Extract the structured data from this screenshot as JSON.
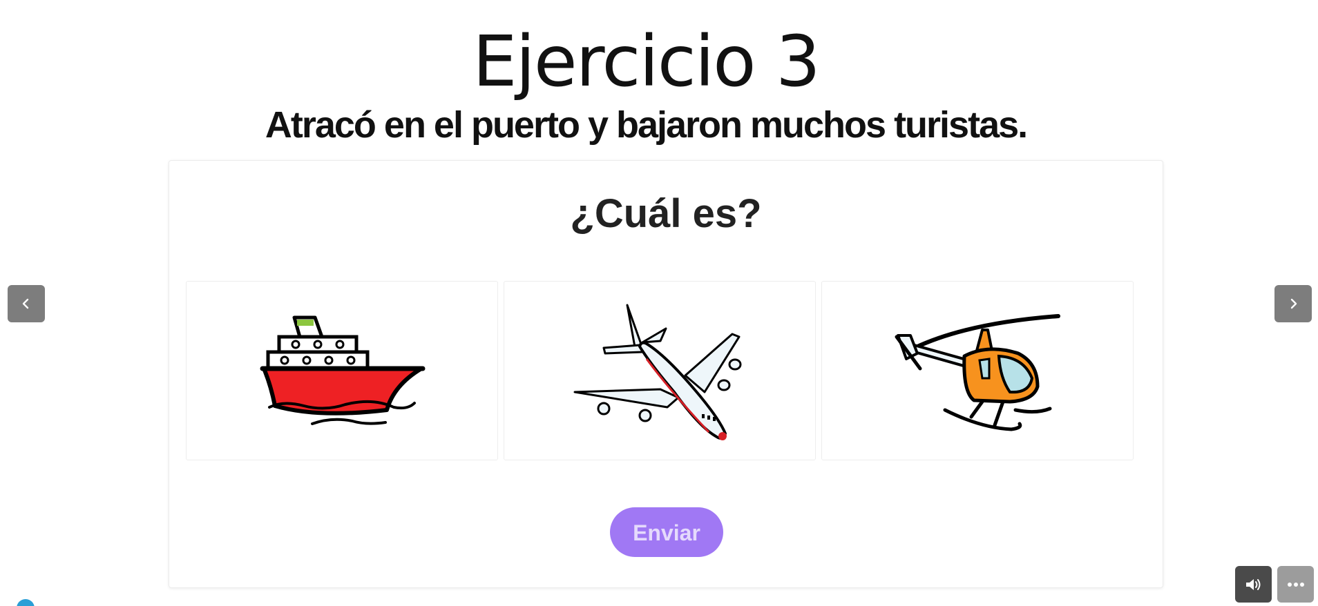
{
  "header": {
    "title": "Ejercicio 3",
    "sentence": "Atracó en el puerto y bajaron muchos turistas."
  },
  "card": {
    "question": "¿Cuál es?",
    "options": [
      {
        "name": "ship",
        "icon": "ship-icon"
      },
      {
        "name": "airplane",
        "icon": "airplane-icon"
      },
      {
        "name": "helicopter",
        "icon": "helicopter-icon"
      }
    ],
    "submit_label": "Enviar"
  },
  "navigation": {
    "prev_icon": "chevron-left-icon",
    "next_icon": "chevron-right-icon"
  },
  "toolbar": {
    "sound_icon": "speaker-icon",
    "more_icon": "more-dots-icon"
  },
  "colors": {
    "accent": "#a078f4",
    "nav_button": "#7d7d7d",
    "ship_hull": "#ee2124",
    "helicopter_body": "#f7921e"
  }
}
